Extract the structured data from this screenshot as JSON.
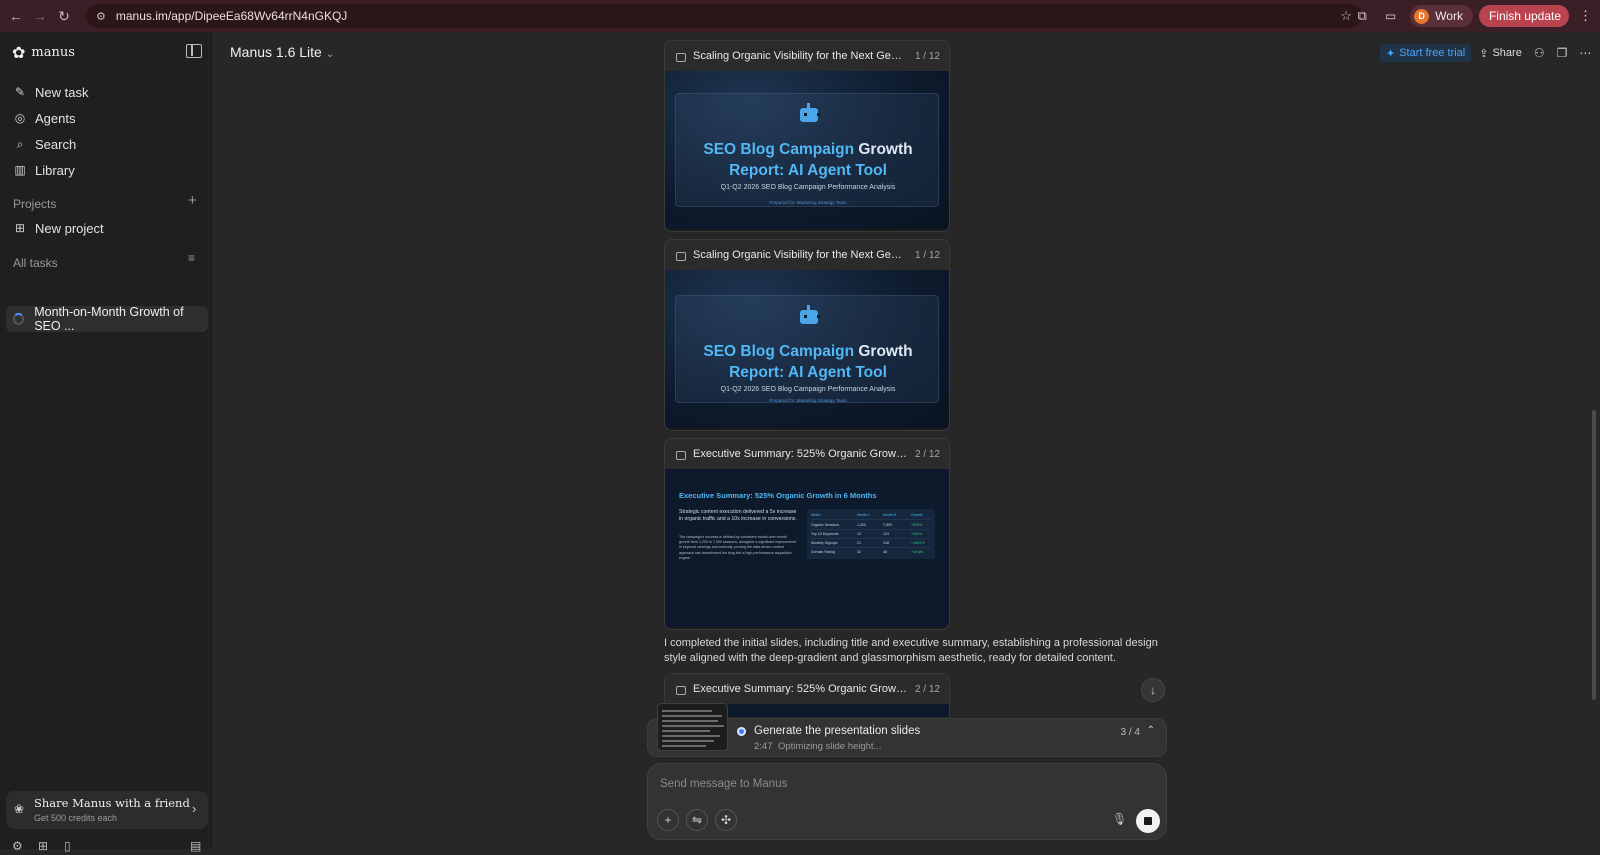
{
  "browser": {
    "url": "manus.im/app/DipeeEa68Wv64rrN4nGKQJ",
    "profile_initial": "D",
    "profile_label": "Work",
    "update_label": "Finish update"
  },
  "sidebar": {
    "brand": "manus",
    "nav": [
      {
        "label": "New task",
        "icon": "edit-icon"
      },
      {
        "label": "Agents",
        "icon": "agents-icon"
      },
      {
        "label": "Search",
        "icon": "search-icon"
      },
      {
        "label": "Library",
        "icon": "library-icon"
      }
    ],
    "projects_label": "Projects",
    "new_project_label": "New project",
    "all_tasks_label": "All tasks",
    "tasks": [
      {
        "label": "Month-on-Month Growth of SEO ..."
      }
    ],
    "share": {
      "title": "Share Manus with a friend",
      "subtitle": "Get 500 credits each"
    }
  },
  "header": {
    "model": "Manus 1.6 Lite",
    "trial_label": "Start free trial",
    "share_label": "Share"
  },
  "cards": [
    {
      "title": "Scaling Organic Visibility for the Next Genera...",
      "page": "1 / 12",
      "slide": {
        "title_a": "SEO Blog Campaign ",
        "title_b": "Growth",
        "title_c": "Report: AI Agent Tool",
        "subtitle": "Q1-Q2 2026 SEO Blog Campaign Performance Analysis",
        "footer": "Prepared for: Marketing Strategy Team"
      }
    },
    {
      "title": "Scaling Organic Visibility for the Next Genera...",
      "page": "1 / 12",
      "slide": {
        "title_a": "SEO Blog Campaign ",
        "title_b": "Growth",
        "title_c": "Report: AI Agent Tool",
        "subtitle": "Q1-Q2 2026 SEO Blog Campaign Performance Analysis",
        "footer": "Prepared for: Marketing Strategy Team"
      }
    },
    {
      "title": "Executive Summary: 525% Organic Growth i...",
      "page": "2 / 12",
      "exec": {
        "title": "Executive Summary: 525% Organic Growth in 6 Months",
        "para1": "Strategic content execution delivered a 5x increase in organic traffic and a 10x increase in conversions.",
        "para2": "The campaign's success is defined by consistent month-over-month growth from 1,200 to 7,500 sessions, alongside a significant improvement in keyword rankings and authority, proving the data-driven content approach has transformed the blog into a high-performance acquisition engine.",
        "table": {
          "headers": [
            "Metric",
            "Month 1",
            "Month 6",
            "Growth"
          ],
          "rows": [
            [
              "Organic Sessions",
              "1,200",
              "7,500",
              "+525%"
            ],
            [
              "Top 10 Keywords",
              "12",
              "124",
              "+933%"
            ],
            [
              "Monthly Signups",
              "21",
              "248",
              "+1081%"
            ],
            [
              "Domain Rating",
              "32",
              "48",
              "+16 pts"
            ]
          ]
        }
      }
    },
    {
      "title": "Executive Summary: 525% Organic Growth i...",
      "page": "2 / 12"
    }
  ],
  "message": "I completed the initial slides, including title and executive summary, establishing a professional design style aligned with the deep-gradient and glassmorphism aesthetic, ready for detailed content.",
  "progress": {
    "title": "Generate the presentation slides",
    "time": "2:47",
    "status": "Optimizing slide height...",
    "count": "3 / 4"
  },
  "composer": {
    "placeholder": "Send message to Manus"
  },
  "colors": {
    "accent": "#4aa3ff",
    "update": "#b9444f",
    "growth": "#3ec27a"
  }
}
